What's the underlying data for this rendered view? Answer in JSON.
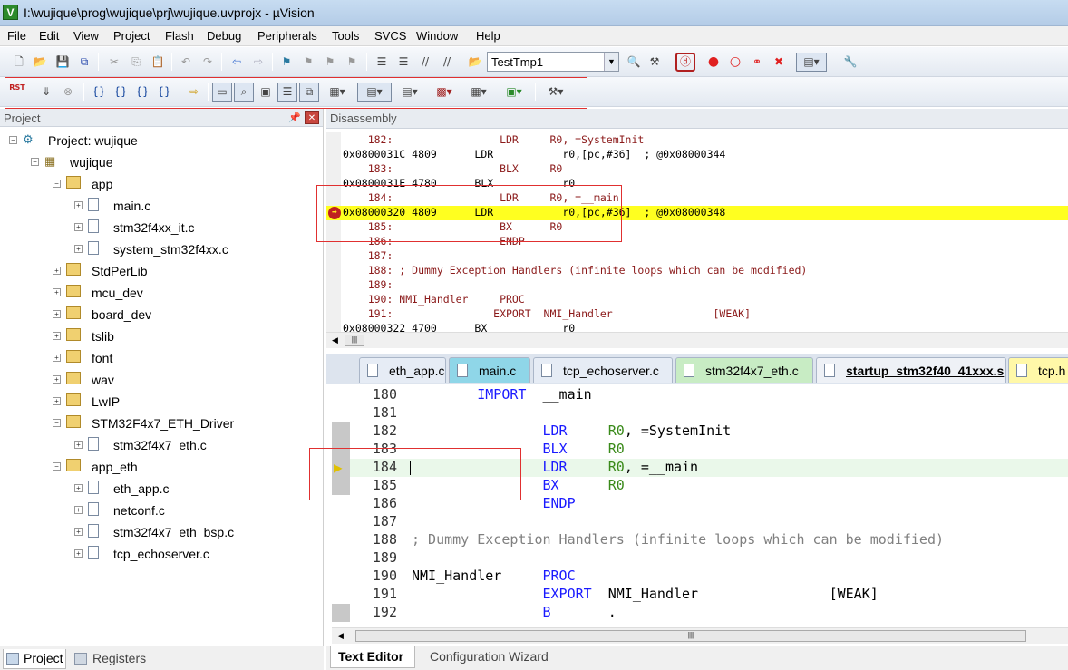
{
  "window": {
    "title": "I:\\wujique\\prog\\wujique\\prj\\wujique.uvprojx - µVision",
    "app_icon": "µVision-icon"
  },
  "menu": [
    "File",
    "Edit",
    "View",
    "Project",
    "Flash",
    "Debug",
    "Peripherals",
    "Tools",
    "SVCS",
    "Window",
    "Help"
  ],
  "toolbar": {
    "target_combo": "TestTmp1",
    "reset_label": "RST"
  },
  "project_panel": {
    "title": "Project",
    "tree": [
      {
        "label": "Project: wujique",
        "level": 0,
        "type": "root",
        "expanded": true
      },
      {
        "label": "wujique",
        "level": 1,
        "type": "target",
        "expanded": true
      },
      {
        "label": "app",
        "level": 2,
        "type": "folder",
        "expanded": true
      },
      {
        "label": "main.c",
        "level": 3,
        "type": "file"
      },
      {
        "label": "stm32f4xx_it.c",
        "level": 3,
        "type": "file"
      },
      {
        "label": "system_stm32f4xx.c",
        "level": 3,
        "type": "file"
      },
      {
        "label": "StdPerLib",
        "level": 2,
        "type": "folder",
        "expanded": false
      },
      {
        "label": "mcu_dev",
        "level": 2,
        "type": "folder",
        "expanded": false
      },
      {
        "label": "board_dev",
        "level": 2,
        "type": "folder",
        "expanded": false
      },
      {
        "label": "tslib",
        "level": 2,
        "type": "folder",
        "expanded": false
      },
      {
        "label": "font",
        "level": 2,
        "type": "folder",
        "expanded": false
      },
      {
        "label": "wav",
        "level": 2,
        "type": "folder",
        "expanded": false
      },
      {
        "label": "LwIP",
        "level": 2,
        "type": "folder",
        "expanded": false
      },
      {
        "label": "STM32F4x7_ETH_Driver",
        "level": 2,
        "type": "folder",
        "expanded": true
      },
      {
        "label": "stm32f4x7_eth.c",
        "level": 3,
        "type": "file"
      },
      {
        "label": "app_eth",
        "level": 2,
        "type": "folder",
        "expanded": true
      },
      {
        "label": "eth_app.c",
        "level": 3,
        "type": "file"
      },
      {
        "label": "netconf.c",
        "level": 3,
        "type": "file"
      },
      {
        "label": "stm32f4x7_eth_bsp.c",
        "level": 3,
        "type": "file"
      },
      {
        "label": "tcp_echoserver.c",
        "level": 3,
        "type": "file"
      }
    ],
    "bottom_tabs": [
      "Project",
      "Registers"
    ]
  },
  "disassembly": {
    "title": "Disassembly",
    "lines": [
      {
        "text": "    182:                 LDR     R0, =SystemInit",
        "kind": "src"
      },
      {
        "text": "0x0800031C 4809      LDR           r0,[pc,#36]  ; @0x08000344",
        "kind": "asm"
      },
      {
        "text": "    183:                 BLX     R0",
        "kind": "src"
      },
      {
        "text": "0x0800031E 4780      BLX           r0",
        "kind": "asm"
      },
      {
        "text": "    184:                 LDR     R0, =__main",
        "kind": "src"
      },
      {
        "text": "0x08000320 4809      LDR           r0,[pc,#36]  ; @0x08000348",
        "kind": "hl"
      },
      {
        "text": "    185:                 BX      R0",
        "kind": "src"
      },
      {
        "text": "    186:                 ENDP",
        "kind": "src"
      },
      {
        "text": "    187:",
        "kind": "src"
      },
      {
        "text": "    188: ; Dummy Exception Handlers (infinite loops which can be modified)",
        "kind": "src"
      },
      {
        "text": "    189:",
        "kind": "src"
      },
      {
        "text": "    190: NMI_Handler     PROC",
        "kind": "src"
      },
      {
        "text": "    191:                EXPORT  NMI_Handler                [WEAK]",
        "kind": "src"
      },
      {
        "text": "0x08000322 4700      BX            r0",
        "kind": "asm"
      }
    ]
  },
  "editor": {
    "tabs": [
      {
        "label": "eth_app.c",
        "color": "#e6ecf5"
      },
      {
        "label": "main.c",
        "color": "#8fd6e8"
      },
      {
        "label": "tcp_echoserver.c",
        "color": "#e6ecf5"
      },
      {
        "label": "stm32f4x7_eth.c",
        "color": "#c8ecc4"
      },
      {
        "label": "startup_stm32f40_41xxx.s",
        "color": "#eef1f6"
      },
      {
        "label": "tcp.h",
        "color": "#fff8a8"
      }
    ],
    "lines": [
      {
        "n": "180",
        "parts": [
          [
            "        ",
            ""
          ],
          [
            "IMPORT",
            "kw"
          ],
          [
            "  __main",
            ""
          ]
        ]
      },
      {
        "n": "181",
        "parts": []
      },
      {
        "n": "182",
        "parts": [
          [
            "                ",
            ""
          ],
          [
            "LDR",
            "kw"
          ],
          [
            "     ",
            ""
          ],
          [
            "R0",
            "rg"
          ],
          [
            ", =SystemInit",
            ""
          ]
        ],
        "bm": true
      },
      {
        "n": "183",
        "parts": [
          [
            "                ",
            ""
          ],
          [
            "BLX",
            "kw"
          ],
          [
            "     ",
            ""
          ],
          [
            "R0",
            "rg"
          ]
        ],
        "bm": true
      },
      {
        "n": "184",
        "parts": [
          [
            "                ",
            ""
          ],
          [
            "LDR",
            "kw"
          ],
          [
            "     ",
            ""
          ],
          [
            "R0",
            "rg"
          ],
          [
            ", =__main",
            ""
          ]
        ],
        "bm": true,
        "current": true
      },
      {
        "n": "185",
        "parts": [
          [
            "                ",
            ""
          ],
          [
            "BX",
            "kw"
          ],
          [
            "      ",
            ""
          ],
          [
            "R0",
            "rg"
          ]
        ],
        "bm": true
      },
      {
        "n": "186",
        "parts": [
          [
            "                ",
            ""
          ],
          [
            "ENDP",
            "kw"
          ]
        ]
      },
      {
        "n": "187",
        "parts": []
      },
      {
        "n": "188",
        "parts": [
          [
            "; Dummy Exception Handlers (infinite loops which can be modified)",
            "cm"
          ]
        ]
      },
      {
        "n": "189",
        "parts": []
      },
      {
        "n": "190",
        "parts": [
          [
            "NMI_Handler     ",
            ""
          ],
          [
            "PROC",
            "kw"
          ]
        ]
      },
      {
        "n": "191",
        "parts": [
          [
            "                ",
            ""
          ],
          [
            "EXPORT",
            "kw"
          ],
          [
            "  NMI_Handler                [WEAK]",
            ""
          ]
        ]
      },
      {
        "n": "192",
        "parts": [
          [
            "                ",
            ""
          ],
          [
            "B",
            "kw"
          ],
          [
            "       .",
            ""
          ]
        ],
        "bm": true
      }
    ],
    "bottom_tabs": [
      "Text Editor",
      "Configuration Wizard"
    ]
  }
}
